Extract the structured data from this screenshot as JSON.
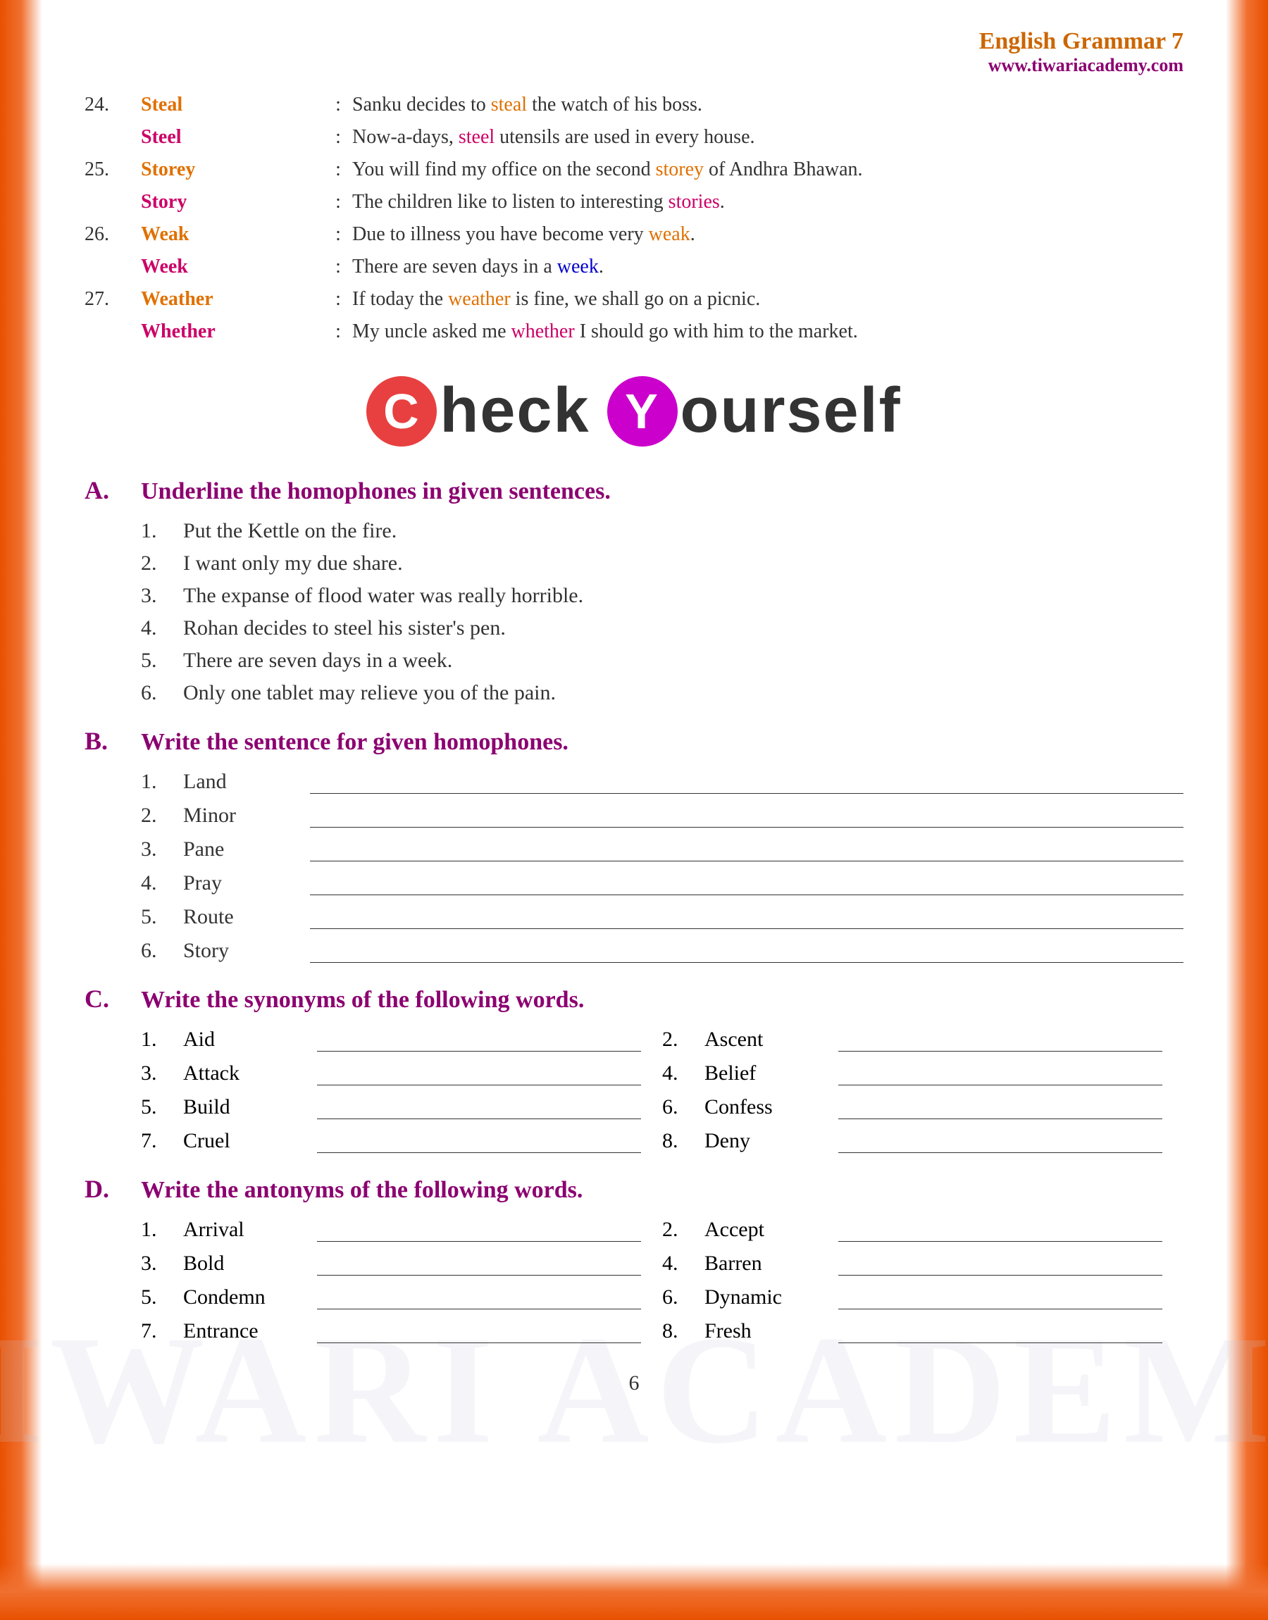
{
  "header": {
    "title": "English Grammar 7",
    "url": "www.tiwariacademy.com"
  },
  "vocabulary": [
    {
      "num": "24.",
      "word1": "Steal",
      "word1_color": "orange",
      "sentence1": "Sanku decides to steal the watch of his boss.",
      "highlight1": "steal",
      "highlight1_color": "orange",
      "word2": "Steel",
      "word2_color": "pink",
      "sentence2": "Now-a-days, steel utensils are used in every house.",
      "highlight2": "steel",
      "highlight2_color": "pink"
    },
    {
      "num": "25.",
      "word1": "Storey",
      "word1_color": "orange",
      "sentence1": "You will find my office on the second storey of Andhra Bhawan.",
      "highlight1": "storey",
      "highlight1_color": "orange",
      "word2": "Story",
      "word2_color": "pink",
      "sentence2": "The children like to listen to interesting stories.",
      "highlight2": "stories",
      "highlight2_color": "pink"
    },
    {
      "num": "26.",
      "word1": "Weak",
      "word1_color": "orange",
      "sentence1": "Due to illness you have become very weak.",
      "highlight1": "weak",
      "highlight1_color": "orange",
      "word2": "Week",
      "word2_color": "pink",
      "sentence2": "There are seven days in a week.",
      "highlight2": "week",
      "highlight2_color": "blue"
    },
    {
      "num": "27.",
      "word1": "Weather",
      "word1_color": "orange",
      "sentence1": "If today the weather is fine, we shall go on a picnic.",
      "highlight1": "weather",
      "highlight1_color": "orange",
      "word2": "Whether",
      "word2_color": "pink",
      "sentence2": "My uncle asked me whether I should go with him to the market.",
      "highlight2": "whether",
      "highlight2_color": "pink"
    }
  ],
  "check_yourself": {
    "c_letter": "C",
    "heck": "heck",
    "y_letter": "Y",
    "ourself": "ourself"
  },
  "section_a": {
    "letter": "A.",
    "title": "Underline the homophones in given sentences.",
    "items": [
      "Put the Kettle on the fire.",
      "I want only my due share.",
      "The expanse of flood water was really horrible.",
      "Rohan decides to steel his sister's pen.",
      "There are seven days in a week.",
      "Only one tablet may relieve you of the pain."
    ]
  },
  "section_b": {
    "letter": "B.",
    "title": "Write the sentence for given homophones.",
    "items": [
      "Land",
      "Minor",
      "Pane",
      "Pray",
      "Route",
      "Story"
    ]
  },
  "section_c": {
    "letter": "C.",
    "title": "Write the synonyms of the following words.",
    "items": [
      {
        "num": "1.",
        "word": "Aid"
      },
      {
        "num": "2.",
        "word": "Ascent"
      },
      {
        "num": "3.",
        "word": "Attack"
      },
      {
        "num": "4.",
        "word": "Belief"
      },
      {
        "num": "5.",
        "word": "Build"
      },
      {
        "num": "6.",
        "word": "Confess"
      },
      {
        "num": "7.",
        "word": "Cruel"
      },
      {
        "num": "8.",
        "word": "Deny"
      }
    ]
  },
  "section_d": {
    "letter": "D.",
    "title": "Write the antonyms of the following words.",
    "items": [
      {
        "num": "1.",
        "word": "Arrival"
      },
      {
        "num": "2.",
        "word": "Accept"
      },
      {
        "num": "3.",
        "word": "Bold"
      },
      {
        "num": "4.",
        "word": "Barren"
      },
      {
        "num": "5.",
        "word": "Condemn"
      },
      {
        "num": "6.",
        "word": "Dynamic"
      },
      {
        "num": "7.",
        "word": "Entrance"
      },
      {
        "num": "8.",
        "word": "Fresh"
      }
    ]
  },
  "page_number": "6"
}
